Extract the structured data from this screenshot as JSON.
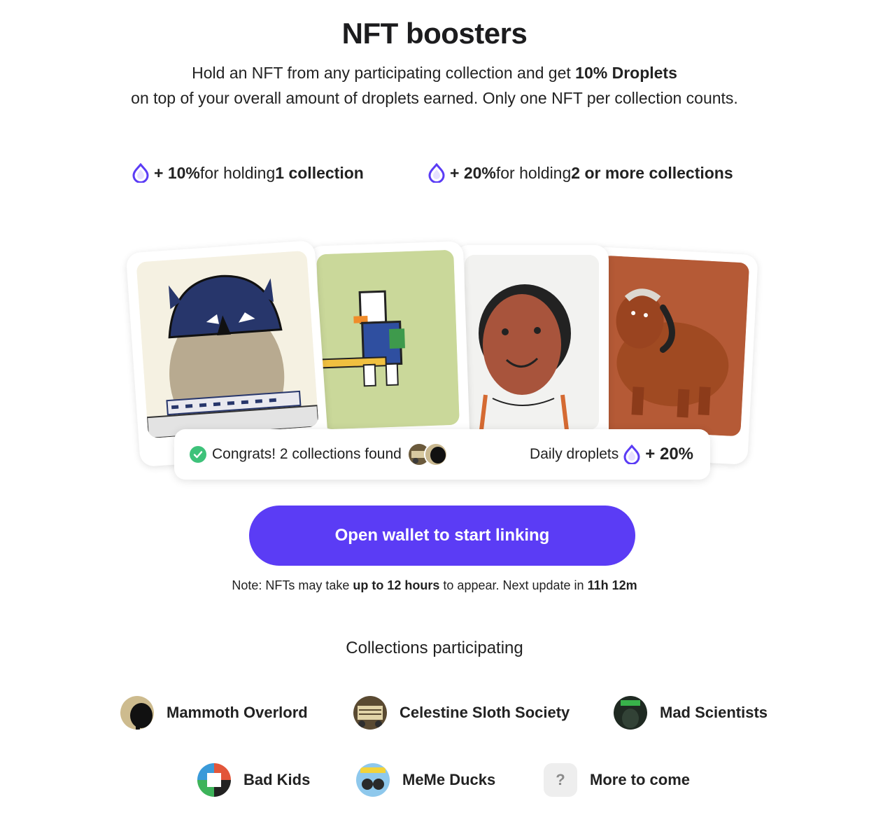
{
  "header": {
    "title": "NFT boosters",
    "subtitle_line1_pre": "Hold an NFT from any participating collection and get ",
    "subtitle_line1_bold": "10% Droplets",
    "subtitle_line2": "on top of your overall amount of droplets earned. Only one NFT per collection counts."
  },
  "boosts": [
    {
      "amount": "+ 10%",
      "text": " for holding ",
      "bold": "1 collection",
      "icon": "droplet-icon"
    },
    {
      "amount": "+ 20%",
      "text": " for holding ",
      "bold": "2 or more collections",
      "icon": "droplet-icon"
    }
  ],
  "status": {
    "congrats": "Congrats! 2 collections found",
    "daily_label": "Daily droplets",
    "daily_value": "+ 20%"
  },
  "cta": {
    "label": "Open wallet to start linking"
  },
  "note": {
    "pre": "Note: NFTs may take ",
    "bold1": "up to 12 hours",
    "mid": " to appear. Next update in ",
    "bold2": "11h 12m"
  },
  "collections": {
    "title": "Collections participating",
    "items": [
      {
        "name": "Mammoth Overlord"
      },
      {
        "name": "Celestine Sloth Society"
      },
      {
        "name": "Mad Scientists"
      },
      {
        "name": "Bad Kids"
      },
      {
        "name": "MeMe Ducks"
      },
      {
        "name": "More to come",
        "icon_glyph": "?"
      }
    ]
  },
  "colors": {
    "accent": "#5b3cf5",
    "success": "#3ec27a",
    "text": "#1c1c1e"
  }
}
